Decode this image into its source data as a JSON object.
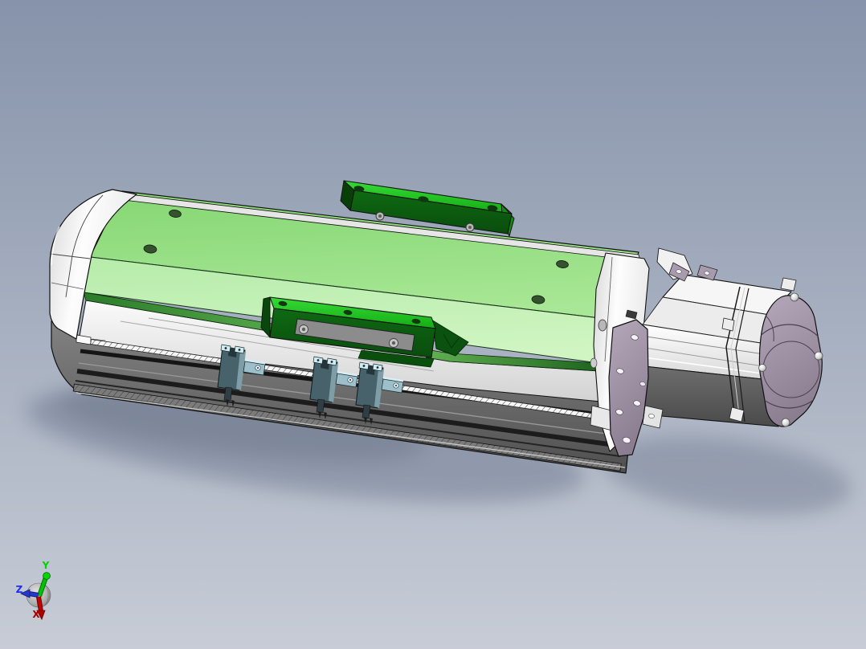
{
  "viewport": {
    "type": "cad-3d-shaded-view",
    "background_top_color": "#8693aa",
    "background_bottom_color": "#c7ccd6"
  },
  "model": {
    "name": "linear actuator module with stepper motor",
    "parts": [
      {
        "name": "end-cap-left",
        "color": "#f2f2f2"
      },
      {
        "name": "top-cover",
        "color": "#a9e795"
      },
      {
        "name": "base-extrusion",
        "color": "#666666"
      },
      {
        "name": "carriage-block-top",
        "color": "#1fc41f",
        "top_holes": 3,
        "side_screws": 2
      },
      {
        "name": "carriage-block-side",
        "color": "#1fc41f",
        "top_holes": 3,
        "side_screws": 2
      },
      {
        "name": "sensor-bracket",
        "color": "#4a666e",
        "count": 3
      },
      {
        "name": "leadscrew-spring",
        "color": "#f6f6f6"
      },
      {
        "name": "motor-flange",
        "color": "#a99cb0",
        "holes": 6
      },
      {
        "name": "stepper-motor",
        "color": "#ededed"
      },
      {
        "name": "motor-end-bell",
        "color": "#a89bac",
        "corner_screws": 4
      },
      {
        "name": "cover-holes",
        "count": 4
      }
    ]
  },
  "triad": {
    "axes": [
      {
        "label": "Z",
        "color": "#1f2bee"
      },
      {
        "label": "Y",
        "color": "#00d400"
      },
      {
        "label": "X",
        "color": "#a80000"
      }
    ]
  }
}
